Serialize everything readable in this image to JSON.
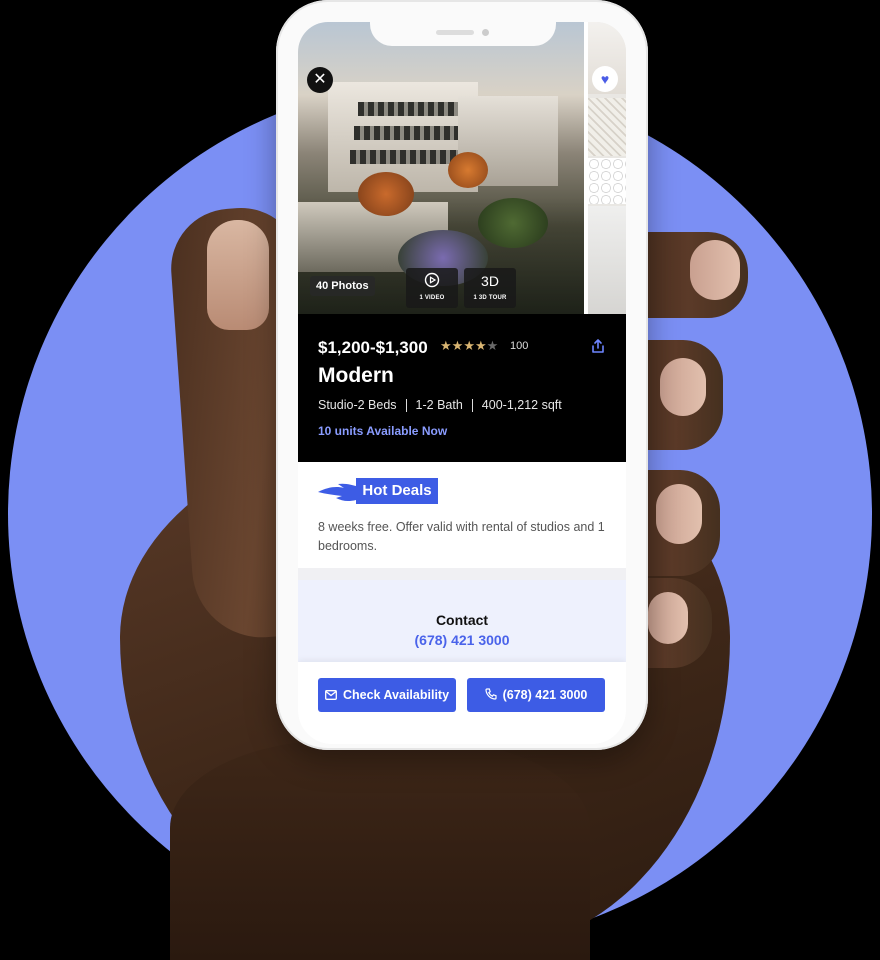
{
  "gallery": {
    "photos_label": "40 Photos",
    "video_icon": "play-circle-icon",
    "video_label": "1 VIDEO",
    "tour_icon_text": "3D",
    "tour_label": "1 3D TOUR",
    "close_icon": "close-icon",
    "favorite_icon": "heart-icon"
  },
  "listing": {
    "price": "$1,200-$1,300",
    "rating_stars": 4,
    "rating_max": 5,
    "review_count": "100",
    "share_icon": "share-icon",
    "name": "Modern",
    "beds": "Studio-2 Beds",
    "baths": "1-2 Bath",
    "sqft": "400-1,212 sqft",
    "availability": "10 units Available Now"
  },
  "deals": {
    "badge": "Hot Deals",
    "description": "8 weeks free. Offer valid with rental of studios and 1 bedrooms."
  },
  "contact": {
    "title": "Contact",
    "phone": "(678) 421 3000"
  },
  "actions": {
    "check_availability": "Check Availability",
    "check_icon": "mail-icon",
    "call": "(678) 421 3000",
    "call_icon": "phone-icon"
  },
  "colors": {
    "accent": "#3d5ce5",
    "background_circle": "#7b8ff4",
    "star": "#d9b572"
  }
}
